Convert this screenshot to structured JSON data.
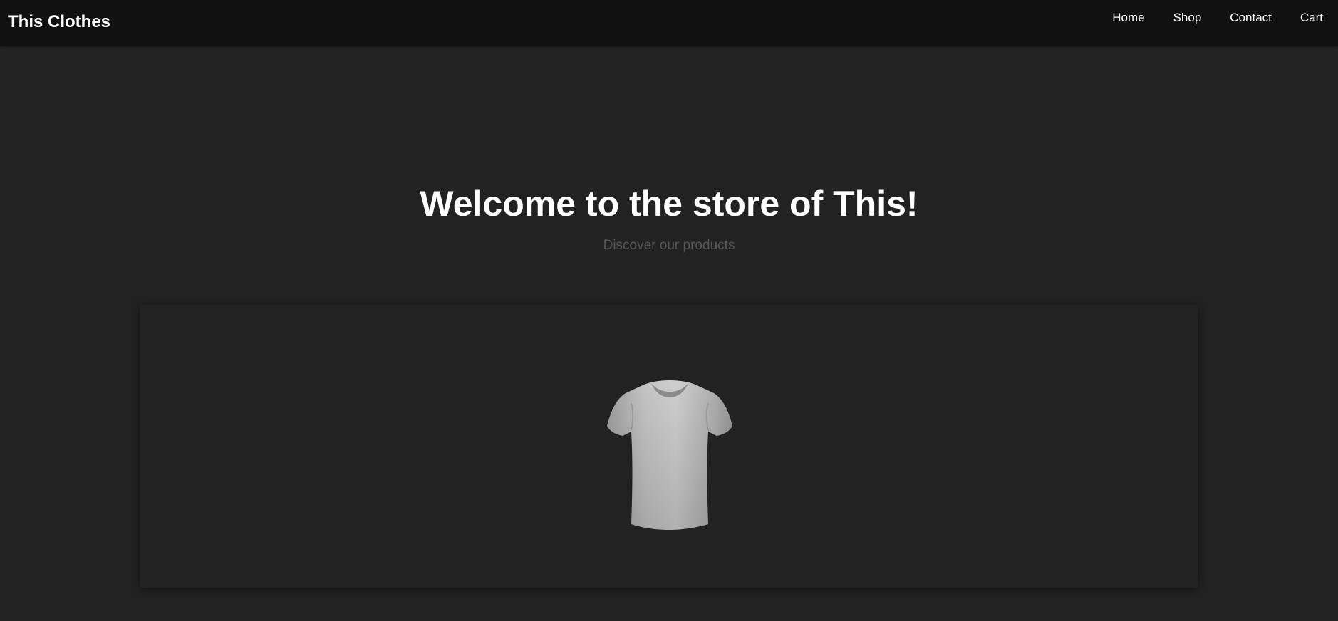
{
  "header": {
    "brand": "This Clothes",
    "nav": [
      {
        "label": "Home"
      },
      {
        "label": "Shop"
      },
      {
        "label": "Contact"
      },
      {
        "label": "Cart"
      }
    ]
  },
  "hero": {
    "title": "Welcome to the store of This!",
    "subtitle": "Discover our products"
  },
  "showcase": {
    "product_icon": "tshirt-icon"
  },
  "colors": {
    "page_background": "#222222",
    "header_background": "#111111",
    "text_primary": "#ffffff",
    "text_muted": "#555555",
    "shirt": "#bdbdbd"
  }
}
